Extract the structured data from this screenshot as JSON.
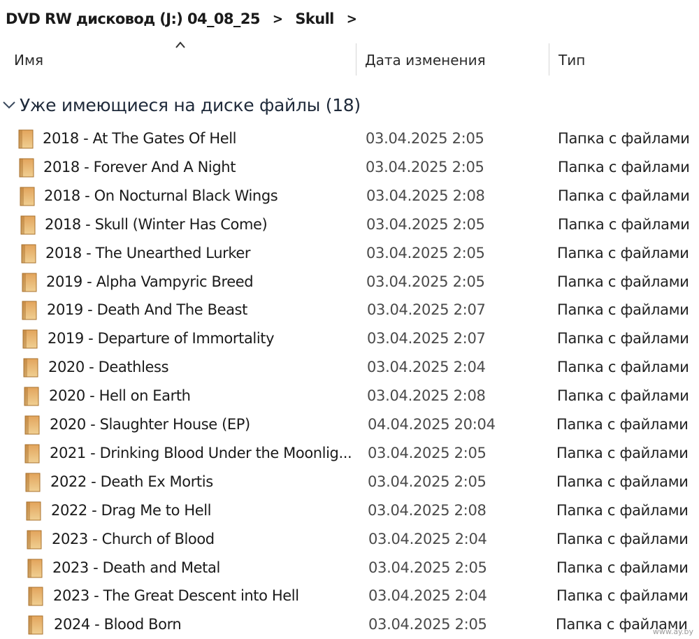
{
  "breadcrumb": {
    "segments": [
      "DVD RW дисковод (J:) 04_08_25",
      "Skull"
    ],
    "separator": ">"
  },
  "columns": {
    "name": "Имя",
    "date": "Дата изменения",
    "type": "Тип"
  },
  "group": {
    "label": "Уже имеющиеся на диске файлы (18)"
  },
  "files": [
    {
      "name": "2018 - At The Gates Of Hell",
      "date": "03.04.2025 2:05",
      "type": "Папка с файлами"
    },
    {
      "name": "2018 - Forever And A Night",
      "date": "03.04.2025 2:05",
      "type": "Папка с файлами"
    },
    {
      "name": "2018 - On Nocturnal Black Wings",
      "date": "03.04.2025 2:08",
      "type": "Папка с файлами"
    },
    {
      "name": "2018 - Skull (Winter Has Come)",
      "date": "03.04.2025 2:05",
      "type": "Папка с файлами"
    },
    {
      "name": "2018 - The Unearthed Lurker",
      "date": "03.04.2025 2:05",
      "type": "Папка с файлами"
    },
    {
      "name": "2019 - Alpha Vampyric Breed",
      "date": "03.04.2025 2:05",
      "type": "Папка с файлами"
    },
    {
      "name": "2019 - Death And The Beast",
      "date": "03.04.2025 2:07",
      "type": "Папка с файлами"
    },
    {
      "name": "2019 - Departure of Immortality",
      "date": "03.04.2025 2:07",
      "type": "Папка с файлами"
    },
    {
      "name": "2020 - Deathless",
      "date": "03.04.2025 2:04",
      "type": "Папка с файлами"
    },
    {
      "name": "2020 - Hell on Earth",
      "date": "03.04.2025 2:08",
      "type": "Папка с файлами"
    },
    {
      "name": "2020 - Slaughter House (EP)",
      "date": "04.04.2025 20:04",
      "type": "Папка с файлами"
    },
    {
      "name": "2021 - Drinking Blood Under the Moonlig...",
      "date": "03.04.2025 2:05",
      "type": "Папка с файлами"
    },
    {
      "name": "2022 - Death Ex Mortis",
      "date": "03.04.2025 2:05",
      "type": "Папка с файлами"
    },
    {
      "name": "2022 - Drag Me to Hell",
      "date": "03.04.2025 2:08",
      "type": "Папка с файлами"
    },
    {
      "name": "2023 - Church of Blood",
      "date": "03.04.2025 2:04",
      "type": "Папка с файлами"
    },
    {
      "name": "2023 - Death and Metal",
      "date": "03.04.2025 2:05",
      "type": "Папка с файлами"
    },
    {
      "name": "2023 - The Great Descent into Hell",
      "date": "03.04.2025 2:04",
      "type": "Папка с файлами"
    },
    {
      "name": "2024 - Blood Born",
      "date": "03.04.2025 2:05",
      "type": "Папка с файлами"
    }
  ],
  "colors": {
    "folder_fill_top": "#e2a45c",
    "folder_fill_bottom": "#f0cf92",
    "folder_outline": "#a8722e"
  },
  "icons": {
    "folder": "folder-icon",
    "sort": "sort-ascending-icon",
    "group_toggle": "chevron-down-icon",
    "breadcrumb_separator": "chevron-right-icon"
  },
  "watermark": "www.ay.by"
}
